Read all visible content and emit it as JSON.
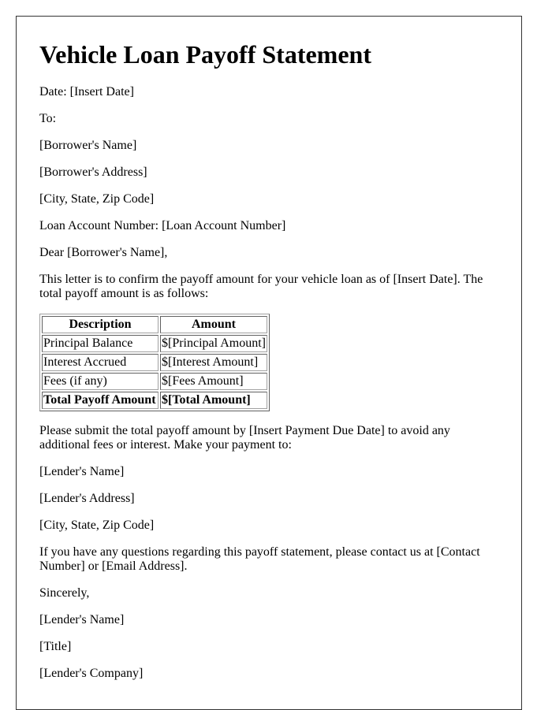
{
  "document": {
    "title": "Vehicle Loan Payoff Statement",
    "date_line": "Date: [Insert Date]",
    "to_label": "To:",
    "recipient": {
      "name": "[Borrower's Name]",
      "address": "[Borrower's Address]",
      "city_state_zip": "[City, State, Zip Code]"
    },
    "loan_account_line": "Loan Account Number: [Loan Account Number]",
    "salutation": "Dear [Borrower's Name],",
    "intro_paragraph": "This letter is to confirm the payoff amount for your vehicle loan as of [Insert Date]. The total payoff amount is as follows:",
    "table": {
      "headers": [
        "Description",
        "Amount"
      ],
      "rows": [
        {
          "description": "Principal Balance",
          "amount": "$[Principal Amount]"
        },
        {
          "description": "Interest Accrued",
          "amount": "$[Interest Amount]"
        },
        {
          "description": "Fees (if any)",
          "amount": "$[Fees Amount]"
        },
        {
          "description": "Total Payoff Amount",
          "amount": "$[Total Amount]"
        }
      ]
    },
    "payment_paragraph": "Please submit the total payoff amount by [Insert Payment Due Date] to avoid any additional fees or interest. Make your payment to:",
    "lender": {
      "name": "[Lender's Name]",
      "address": "[Lender's Address]",
      "city_state_zip": "[City, State, Zip Code]"
    },
    "contact_paragraph": "If you have any questions regarding this payoff statement, please contact us at [Contact Number] or [Email Address].",
    "closing": "Sincerely,",
    "signature": {
      "name": "[Lender's Name]",
      "title": "[Title]",
      "company": "[Lender's Company]"
    }
  }
}
